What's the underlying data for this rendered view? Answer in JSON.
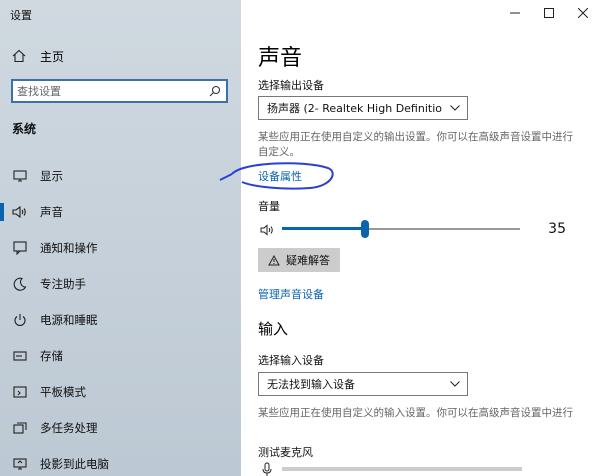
{
  "window": {
    "title": "设置",
    "controls": [
      "minimize",
      "maximize",
      "close"
    ]
  },
  "sidebar": {
    "home_label": "主页",
    "search_placeholder": "查找设置",
    "section_label": "系统",
    "items": [
      {
        "label": "显示",
        "icon": "monitor-icon",
        "active": false
      },
      {
        "label": "声音",
        "icon": "speaker-icon",
        "active": true
      },
      {
        "label": "通知和操作",
        "icon": "notification-icon",
        "active": false
      },
      {
        "label": "专注助手",
        "icon": "moon-icon",
        "active": false
      },
      {
        "label": "电源和睡眠",
        "icon": "power-icon",
        "active": false
      },
      {
        "label": "存储",
        "icon": "storage-icon",
        "active": false
      },
      {
        "label": "平板模式",
        "icon": "tablet-icon",
        "active": false
      },
      {
        "label": "多任务处理",
        "icon": "multitask-icon",
        "active": false
      },
      {
        "label": "投影到此电脑",
        "icon": "project-icon",
        "active": false
      }
    ]
  },
  "main": {
    "title": "声音",
    "output": {
      "label": "选择输出设备",
      "device": "扬声器 (2- Realtek High Definition A...",
      "description": "某些应用正在使用自定义的输出设置。你可以在高级声音设置中进行自定义。",
      "properties_link": "设备属性"
    },
    "volume": {
      "label": "音量",
      "value": 35,
      "value_text": "35"
    },
    "troubleshoot_label": "疑难解答",
    "manage_link": "管理声音设备",
    "input": {
      "heading": "输入",
      "label": "选择输入设备",
      "device": "无法找到输入设备",
      "description": "某些应用正在使用自定义的输入设置。你可以在高级声音设置中进行",
      "test_label": "测试麦克风"
    }
  },
  "colors": {
    "accent": "#0a64ad",
    "annotation": "#2b3fd1",
    "sidebar_bg": "#c7d2db"
  }
}
